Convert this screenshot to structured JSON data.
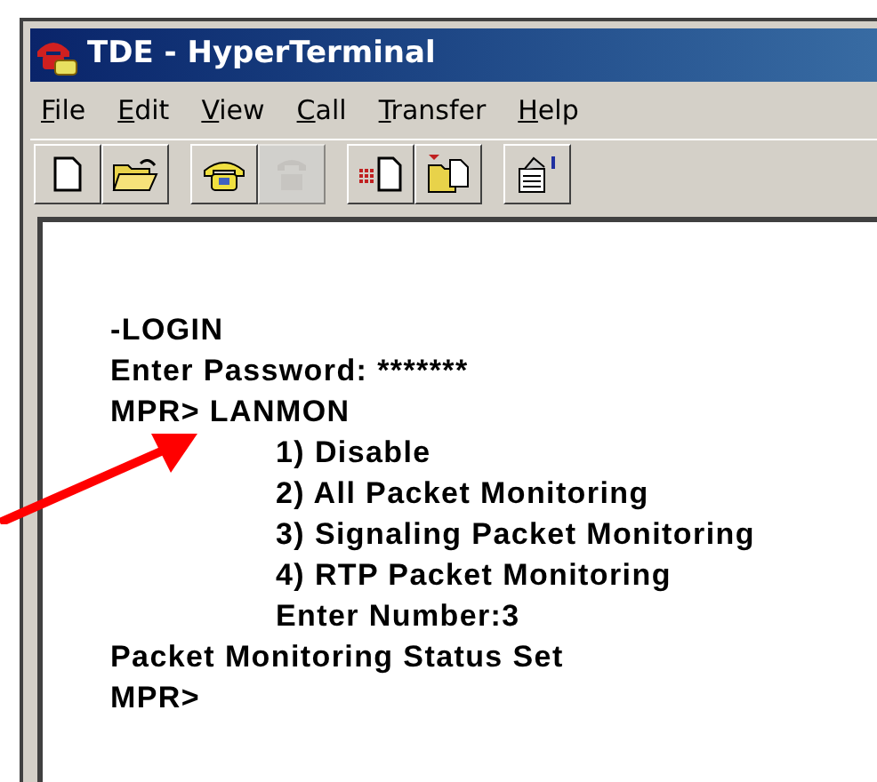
{
  "window": {
    "title": "TDE - HyperTerminal"
  },
  "menu": [
    "File",
    "Edit",
    "View",
    "Call",
    "Transfer",
    "Help"
  ],
  "toolbar": [
    [
      {
        "kind": "new",
        "disabled": false
      },
      {
        "kind": "open",
        "disabled": false
      }
    ],
    [
      {
        "kind": "call",
        "disabled": false
      },
      {
        "kind": "hangup",
        "disabled": true
      }
    ],
    [
      {
        "kind": "send",
        "disabled": false
      },
      {
        "kind": "receive",
        "disabled": false
      }
    ],
    [
      {
        "kind": "properties",
        "disabled": false
      }
    ]
  ],
  "terminal": [
    {
      "text": "-LOGIN"
    },
    {
      "text": "Enter Password: *******"
    },
    {
      "text": "MPR> LANMON",
      "children": [
        {
          "text": "1) Disable"
        },
        {
          "text": "2) All Packet Monitoring"
        },
        {
          "text": "3) Signaling Packet Monitoring"
        },
        {
          "text": "4) RTP Packet Monitoring"
        },
        {
          "text": "Enter Number:3"
        }
      ]
    },
    {
      "text": "Packet Monitoring Status Set"
    },
    {
      "text": "MPR>"
    }
  ]
}
